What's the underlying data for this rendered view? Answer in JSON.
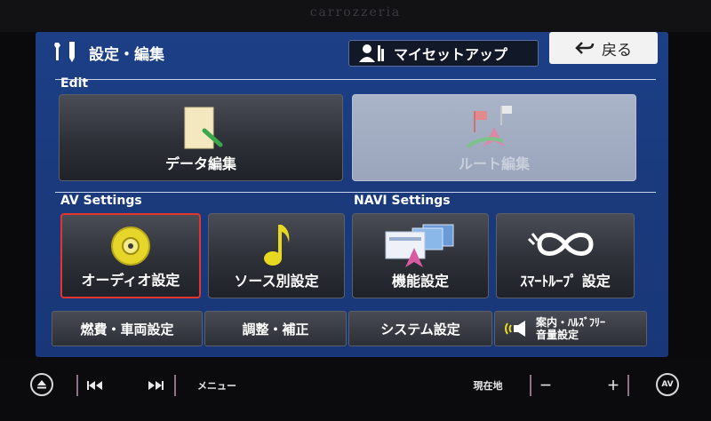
{
  "device": {
    "brand": "carrozzeria"
  },
  "header": {
    "title": "設定・編集",
    "my_setup_label": "マイセットアップ",
    "back_label": "戻る"
  },
  "sections": {
    "edit": "Edit",
    "av": "AV Settings",
    "navi": "NAVI Settings"
  },
  "edit_buttons": {
    "data_edit": "データ編集",
    "route_edit": "ルート編集"
  },
  "av_buttons": {
    "audio_settings": "オーディオ設定",
    "source_settings": "ソース別設定"
  },
  "navi_buttons": {
    "function_settings": "機能設定",
    "smart_loop_settings": "ｽﾏｰﾄﾙｰﾌﾟ 設定"
  },
  "bottom_row": {
    "fuel_vehicle": "燃費・車両設定",
    "adjust_correct": "調整・補正",
    "system_settings": "システム設定",
    "guide_line1": "案内・ﾊﾙｽﾞﾌﾘｰ",
    "guide_line2": "音量設定"
  },
  "hardware": {
    "menu": "メニュー",
    "current_location": "現在地",
    "vol_minus": "－",
    "vol_plus": "＋",
    "av": "AV"
  },
  "colors": {
    "screen_blue": "#1b3c80",
    "selected_border": "#e3352c",
    "disabled_button": "#a3adc2"
  }
}
